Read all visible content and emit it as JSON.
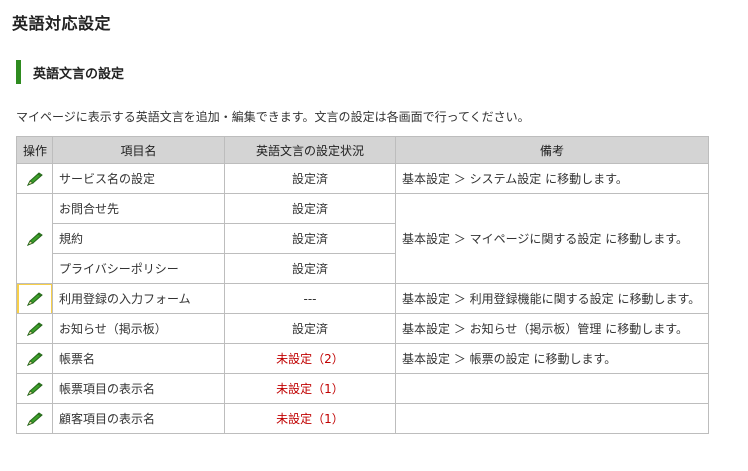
{
  "page": {
    "title": "英語対応設定"
  },
  "section": {
    "title": "英語文言の設定"
  },
  "description": "マイページに表示する英語文言を追加・編集できます。文言の設定は各画面で行ってください。",
  "table": {
    "headers": {
      "op": "操作",
      "item": "項目名",
      "status": "英語文言の設定状況",
      "note": "備考"
    },
    "rows": [
      {
        "item": "サービス名の設定",
        "status": "設定済",
        "note": "基本設定 ＞ システム設定 に移動します。"
      },
      {
        "item": "お問合せ先",
        "status": "設定済",
        "note": "基本設定 ＞ マイページに関する設定 に移動します。"
      },
      {
        "item": "規約",
        "status": "設定済"
      },
      {
        "item": "プライバシーポリシー",
        "status": "設定済"
      },
      {
        "item": "利用登録の入力フォーム",
        "status": "---",
        "note": "基本設定 ＞ 利用登録機能に関する設定 に移動します。"
      },
      {
        "item": "お知らせ（掲示板）",
        "status": "設定済",
        "note": "基本設定 ＞ お知らせ（掲示板）管理 に移動します。"
      },
      {
        "item": "帳票名",
        "status": "未設定（2）",
        "note": "基本設定 ＞ 帳票の設定 に移動します。"
      },
      {
        "item": "帳票項目の表示名",
        "status": "未設定（1）",
        "note": ""
      },
      {
        "item": "顧客項目の表示名",
        "status": "未設定（1）",
        "note": ""
      }
    ]
  },
  "icons": {
    "edit": "pencil-icon"
  },
  "colors": {
    "accent_bar": "#2e8b1f",
    "unset_status": "#c00000",
    "highlight": "#f7cf4a",
    "header_bg": "#d4d4d4"
  }
}
